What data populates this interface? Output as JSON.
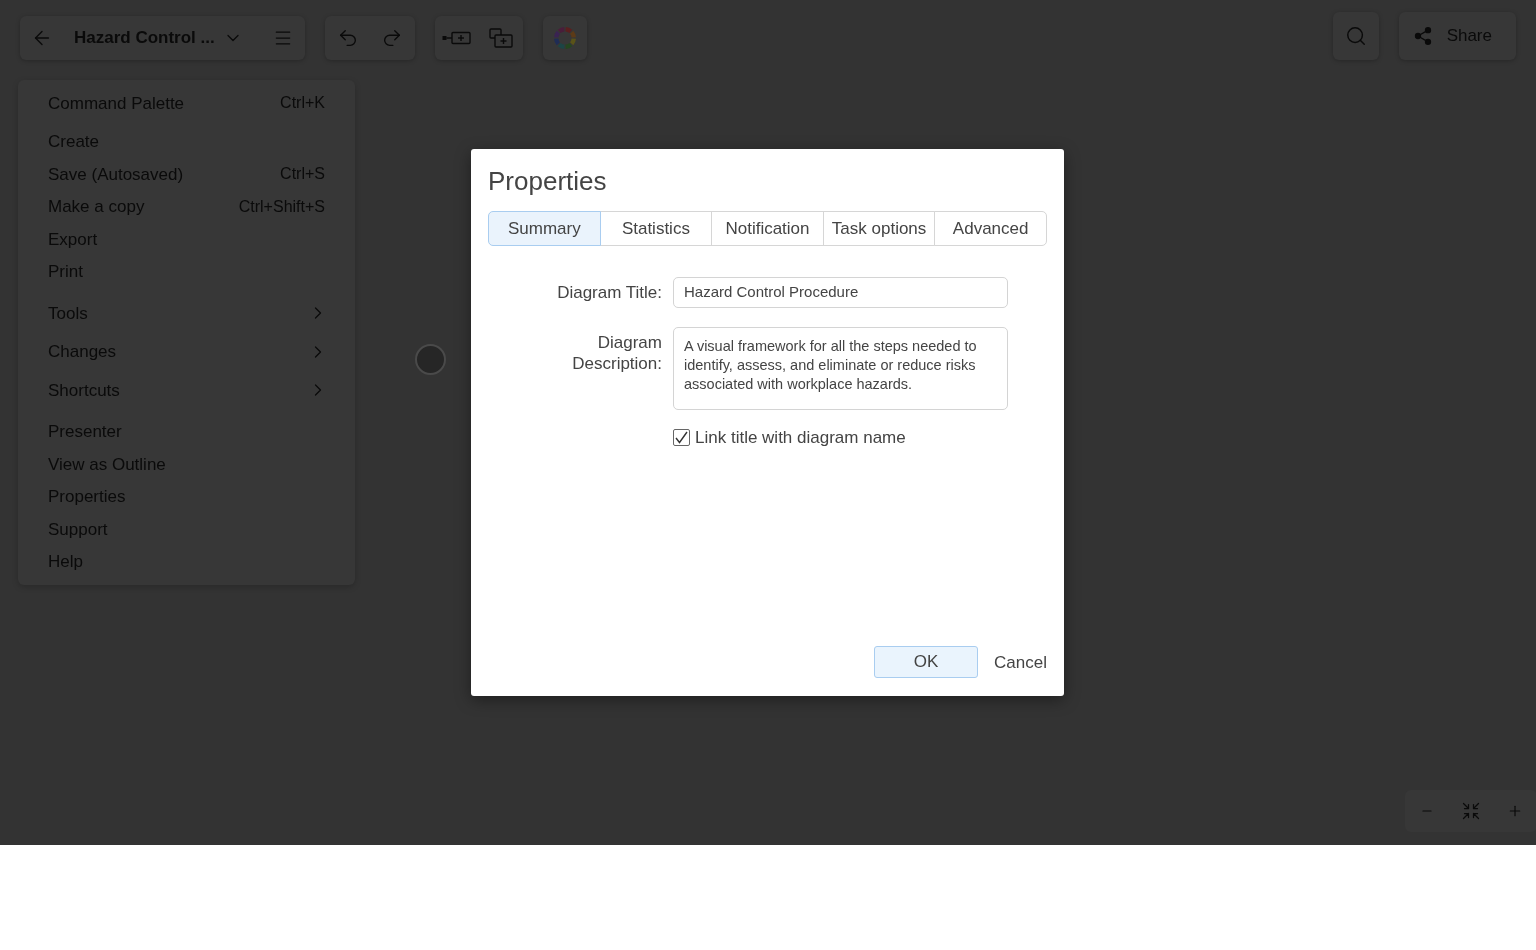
{
  "toolbar": {
    "title": "Hazard Control ...",
    "share_label": "Share"
  },
  "menu": {
    "sections": [
      {
        "items": [
          {
            "label": "Command Palette",
            "shortcut": "Ctrl+K",
            "has_submenu": false
          }
        ]
      },
      {
        "items": [
          {
            "label": "Create",
            "has_submenu": false
          },
          {
            "label": "Save (Autosaved)",
            "shortcut": "Ctrl+S",
            "has_submenu": false
          },
          {
            "label": "Make a copy",
            "shortcut": "Ctrl+Shift+S",
            "has_submenu": false
          },
          {
            "label": "Export",
            "has_submenu": false
          },
          {
            "label": "Print",
            "has_submenu": false
          }
        ]
      },
      {
        "items": [
          {
            "label": "Tools",
            "has_submenu": true
          },
          {
            "label": "Changes",
            "has_submenu": true
          },
          {
            "label": "Shortcuts",
            "has_submenu": true
          }
        ]
      },
      {
        "items": [
          {
            "label": "Presenter",
            "has_submenu": false
          },
          {
            "label": "View as Outline",
            "has_submenu": false
          },
          {
            "label": "Properties",
            "has_submenu": false
          },
          {
            "label": "Support",
            "has_submenu": false
          },
          {
            "label": "Help",
            "has_submenu": false
          }
        ]
      }
    ]
  },
  "dialog": {
    "title": "Properties",
    "tabs": [
      {
        "label": "Summary",
        "selected": true
      },
      {
        "label": "Statistics",
        "selected": false
      },
      {
        "label": "Notification",
        "selected": false
      },
      {
        "label": "Task options",
        "selected": false
      },
      {
        "label": "Advanced",
        "selected": false
      }
    ],
    "fields": [
      {
        "kind": "text",
        "label": "Diagram Title:",
        "value": "Hazard Control Procedure"
      },
      {
        "kind": "textarea",
        "label": "Diagram Description:",
        "value": "A visual framework for all the steps needed to identify, assess, and eliminate or reduce risks associated with workplace hazards."
      }
    ],
    "checkbox": {
      "label": "Link title with diagram name",
      "checked": true
    },
    "buttons": [
      {
        "label": "OK",
        "kind": "primary"
      },
      {
        "label": "Cancel",
        "kind": "plain"
      }
    ]
  }
}
